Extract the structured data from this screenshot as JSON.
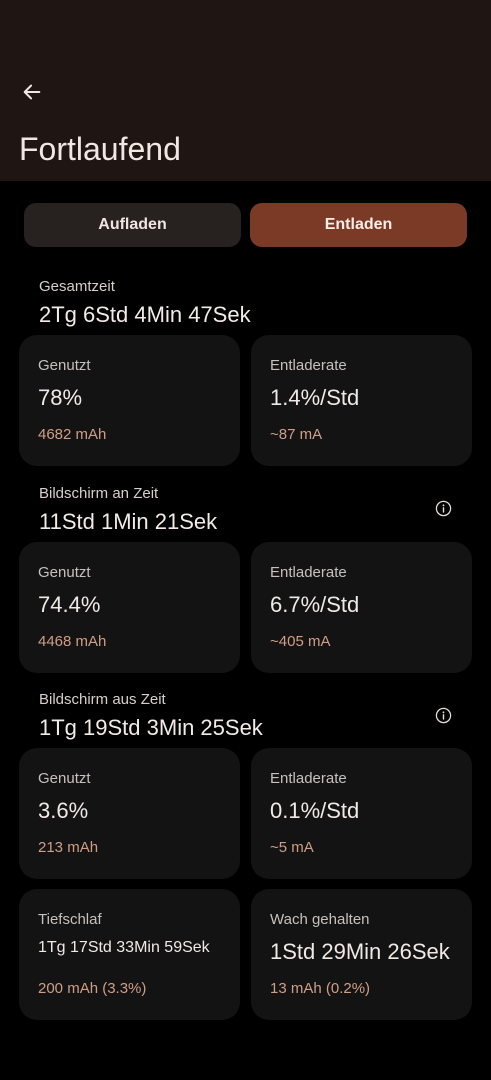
{
  "header": {
    "title": "Fortlaufend",
    "back_icon": "arrow-left-icon"
  },
  "tabs": [
    {
      "label": "Aufladen",
      "selected": false
    },
    {
      "label": "Entladen",
      "selected": true
    }
  ],
  "colors": {
    "header_bg": "#1f1614",
    "selected_tab": "#7b3a26",
    "unselected_tab": "#272120",
    "card_bg": "#131313",
    "accent_text": "#cf9e86"
  },
  "sections": [
    {
      "label": "Gesamtzeit",
      "value": "2Tg 6Std 4Min 47Sek",
      "has_info": false,
      "cards": [
        {
          "label": "Genutzt",
          "value": "78%",
          "sub": "4682 mAh"
        },
        {
          "label": "Entladerate",
          "value": "1.4%/Std",
          "sub": "~87 mA"
        }
      ]
    },
    {
      "label": "Bildschirm an Zeit",
      "value": "11Std 1Min 21Sek",
      "has_info": true,
      "cards": [
        {
          "label": "Genutzt",
          "value": "74.4%",
          "sub": "4468 mAh"
        },
        {
          "label": "Entladerate",
          "value": "6.7%/Std",
          "sub": "~405 mA"
        }
      ]
    },
    {
      "label": "Bildschirm aus Zeit",
      "value": "1Tg 19Std 3Min 25Sek",
      "has_info": true,
      "cards": [
        {
          "label": "Genutzt",
          "value": "3.6%",
          "sub": "213 mAh"
        },
        {
          "label": "Entladerate",
          "value": "0.1%/Std",
          "sub": "~5 mA"
        }
      ]
    }
  ],
  "bottom_cards": [
    {
      "label": "Tiefschlaf",
      "value": "1Tg 17Std 33Min 59Sek",
      "sub": "200 mAh (3.3%)"
    },
    {
      "label": "Wach gehalten",
      "value": "1Std 29Min 26Sek",
      "sub": "13 mAh (0.2%)"
    }
  ]
}
